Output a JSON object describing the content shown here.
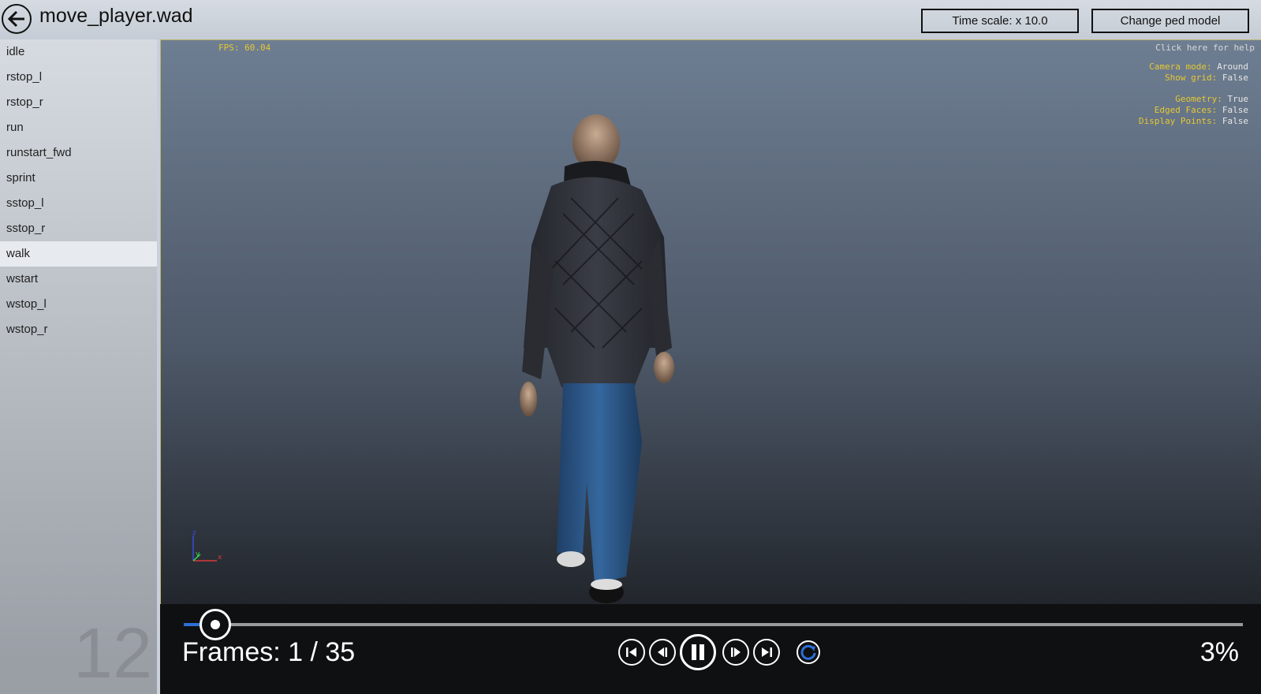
{
  "window": {
    "title": "move_player.wad"
  },
  "toolbar": {
    "time_scale_label": "Time scale: x 10.0",
    "change_ped_label": "Change ped model"
  },
  "sidebar": {
    "items": [
      {
        "label": "idle"
      },
      {
        "label": "rstop_l"
      },
      {
        "label": "rstop_r"
      },
      {
        "label": "run"
      },
      {
        "label": "runstart_fwd"
      },
      {
        "label": "sprint"
      },
      {
        "label": "sstop_l"
      },
      {
        "label": "sstop_r"
      },
      {
        "label": "walk",
        "selected": true
      },
      {
        "label": "wstart"
      },
      {
        "label": "wstop_l"
      },
      {
        "label": "wstop_r"
      }
    ],
    "count_display": "12"
  },
  "viewport": {
    "fps": "FPS: 60.04",
    "help": "Click here for help",
    "camera_mode_key": "Camera mode:",
    "camera_mode_val": "Around",
    "show_grid_key": "Show grid:",
    "show_grid_val": "False",
    "geometry_key": "Geometry:",
    "geometry_val": "True",
    "edged_faces_key": "Edged Faces:",
    "edged_faces_val": "False",
    "display_points_key": "Display Points:",
    "display_points_val": "False",
    "axis": {
      "z": "z",
      "y": "y",
      "x": "x"
    }
  },
  "playback": {
    "frames_label": "Frames: 1 / 35",
    "percent_label": "3%",
    "progress": 0.03
  },
  "colors": {
    "accent": "#2d6fd6",
    "overlay_key": "#e6c832"
  }
}
